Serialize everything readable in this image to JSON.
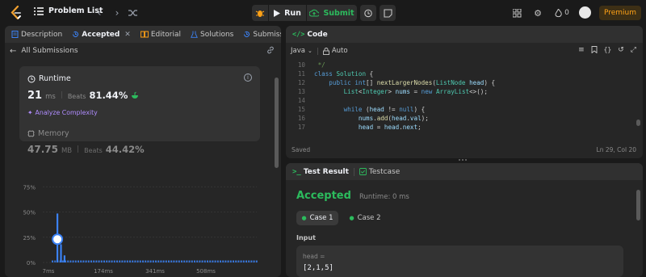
{
  "topbar": {
    "problem_list": "Problem List",
    "run": "Run",
    "submit": "Submit",
    "streak": "0",
    "premium": "Premium"
  },
  "left": {
    "tabs": [
      "Description",
      "Accepted",
      "Editorial",
      "Solutions",
      "Submissions"
    ],
    "all_submissions": "All Submissions",
    "runtime": {
      "title": "Runtime",
      "value": "21",
      "unit": "ms",
      "beats_label": "Beats",
      "beats": "81.44%",
      "analyze": "Analyze Complexity"
    },
    "memory": {
      "title": "Memory",
      "value": "47.75",
      "unit": "MB",
      "beats_label": "Beats",
      "beats": "44.42%"
    }
  },
  "chart_data": {
    "type": "bar",
    "yticks": [
      "75%",
      "50%",
      "25%",
      "0%"
    ],
    "ylim": [
      0,
      0.8
    ],
    "xticks": [
      "7ms",
      "174ms",
      "341ms",
      "508ms"
    ],
    "bars": [
      {
        "x": 21,
        "value": 0.485
      },
      {
        "x": 25,
        "value": 0.18
      },
      {
        "x": 29,
        "value": 0.07
      }
    ],
    "baseline_value": 0.02,
    "marker_x": 21,
    "marker_value": 0.23
  },
  "code": {
    "title": "Code",
    "language": "Java",
    "mode": "Auto",
    "saved": "Saved",
    "position": "Ln 29, Col 20",
    "lines": [
      {
        "n": "10",
        "html": "<span class='cm'> */</span>"
      },
      {
        "n": "11",
        "html": "<span class='kw'>class</span> <span class='ty'>Solution</span> {"
      },
      {
        "n": "12",
        "html": "    <span class='kw'>public</span> <span class='kw'>int</span>[] <span class='fn'>nextLargerNodes</span>(<span class='ty'>ListNode</span> <span class='vr'>head</span>) {"
      },
      {
        "n": "13",
        "html": "        <span class='ty'>List</span>&lt;<span class='ty'>Integer</span>&gt; <span class='vr'>nums</span> = <span class='kw'>new</span> <span class='ty'>ArrayList</span>&lt;&gt;();"
      },
      {
        "n": "14",
        "html": ""
      },
      {
        "n": "15",
        "html": "        <span class='kw'>while</span> (<span class='vr'>head</span> != <span class='kw'>null</span>) {"
      },
      {
        "n": "16",
        "html": "            <span class='vr'>nums</span>.<span class='fn'>add</span>(<span class='vr'>head</span>.<span class='vr'>val</span>);"
      },
      {
        "n": "17",
        "html": "            <span class='vr'>head</span> = <span class='vr'>head</span>.<span class='vr'>next</span>;"
      }
    ]
  },
  "result": {
    "tab_result": "Test Result",
    "tab_testcase": "Testcase",
    "status": "Accepted",
    "runtime": "Runtime: 0 ms",
    "cases": [
      "Case 1",
      "Case 2"
    ],
    "input_label": "Input",
    "var_name": "head =",
    "var_value": "[2,1,5]"
  },
  "colors": {
    "accent_green": "#2cbb5d",
    "bar_blue": "#3b82f6",
    "premium": "#ffa116"
  }
}
